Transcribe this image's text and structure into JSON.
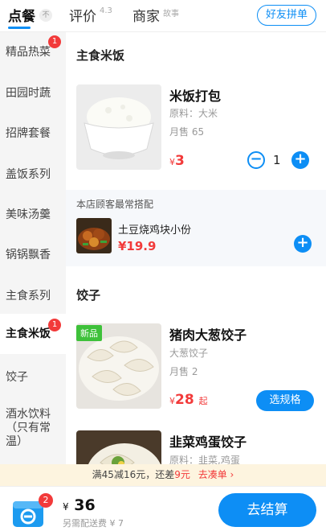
{
  "tabs": {
    "order": "点餐",
    "order_badge": "不",
    "reviews": "评价",
    "reviews_score": "4.3",
    "merchant": "商家",
    "merchant_sup": "故事",
    "group_button": "好友拼单"
  },
  "sidebar": {
    "items": [
      {
        "label": "精品热菜",
        "badge": "1"
      },
      {
        "label": "田园时蔬"
      },
      {
        "label": "招牌套餐"
      },
      {
        "label": "盖饭系列"
      },
      {
        "label": "美味汤羹"
      },
      {
        "label": "锅锅飘香"
      },
      {
        "label": "主食系列"
      },
      {
        "label": "主食米饭",
        "badge": "1",
        "active": true
      },
      {
        "label": "饺子"
      },
      {
        "label": "酒水饮料（只有常温）"
      }
    ]
  },
  "sections": [
    {
      "title": "主食米饭",
      "item": {
        "name": "米饭打包",
        "ingredients": "原料：大米",
        "sales": "月售 65",
        "currency": "¥",
        "price": "3",
        "quantity": "1",
        "image": "rice-bowl"
      },
      "combo": {
        "header": "本店顾客最常搭配",
        "name": "土豆烧鸡块小份",
        "price": "¥19.9",
        "image": "chicken-potato-dish"
      }
    },
    {
      "title": "饺子",
      "items": [
        {
          "tag": "新品",
          "name": "猪肉大葱饺子",
          "ingredients": "大葱饺子",
          "sales": "月售 2",
          "currency": "¥",
          "price": "28",
          "price_suffix": "起",
          "action": "选规格",
          "image": "dumplings"
        },
        {
          "name": "韭菜鸡蛋饺子",
          "ingredients": "原料：韭菜,鸡蛋",
          "image": "dumplings-chive"
        }
      ]
    }
  ],
  "promo": {
    "text_before": "满45减16元，还差",
    "amount": "9元",
    "link": "去凑单 ›"
  },
  "cart": {
    "badge": "2",
    "currency": "¥",
    "total": "36",
    "delivery": "另需配送费 ¥ 7",
    "checkout": "去结算"
  },
  "colors": {
    "accent": "#0d8ef5",
    "price": "#f23a3a",
    "new_tag": "#3ec13a",
    "promo_bg": "#fdf4df"
  }
}
